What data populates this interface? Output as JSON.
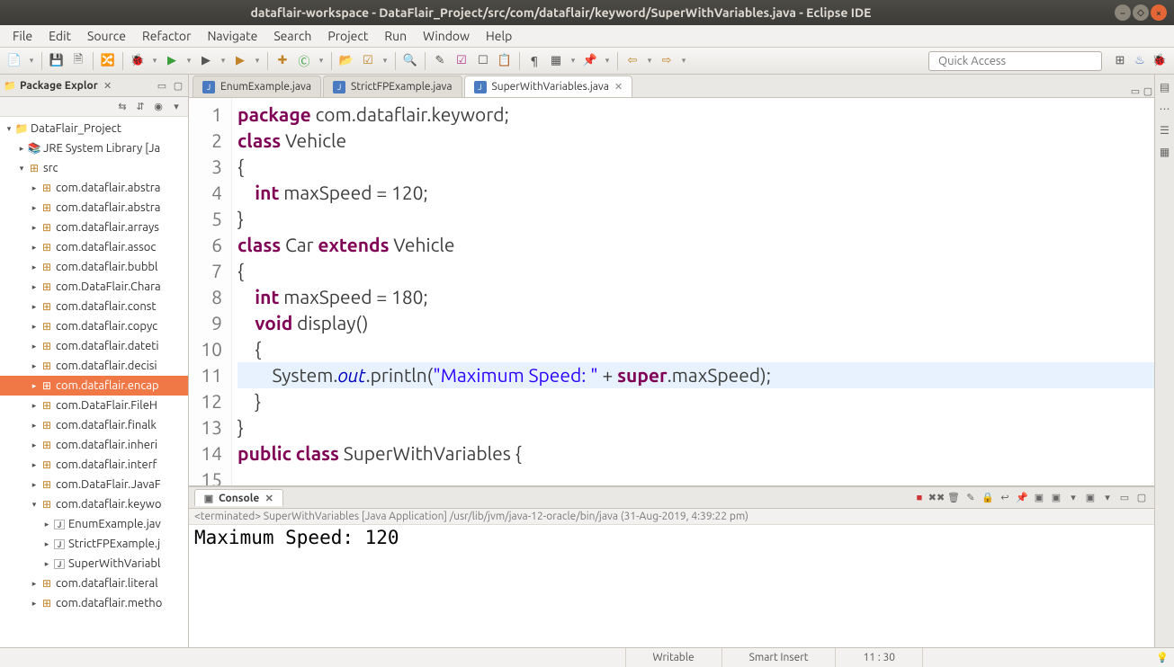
{
  "window": {
    "title": "dataflair-workspace - DataFlair_Project/src/com/dataflair/keyword/SuperWithVariables.java - Eclipse IDE"
  },
  "menu": [
    "File",
    "Edit",
    "Source",
    "Refactor",
    "Navigate",
    "Search",
    "Project",
    "Run",
    "Window",
    "Help"
  ],
  "quick_access": "Quick Access",
  "package_explorer": {
    "title": "Package Explor",
    "project": "DataFlair_Project",
    "jre": "JRE System Library [Ja",
    "src": "src",
    "packages": [
      "com.dataflair.abstra",
      "com.dataflair.abstra",
      "com.dataflair.arrays",
      "com.dataflair.assoc",
      "com.dataflair.bubbl",
      "com.DataFlair.Chara",
      "com.dataflair.const",
      "com.dataflair.copyc",
      "com.dataflair.dateti",
      "com.dataflair.decisi",
      "com.dataflair.encap",
      "com.DataFlair.FileH",
      "com.dataflair.finalk",
      "com.dataflair.inheri",
      "com.dataflair.interf",
      "com.DataFlair.JavaF",
      "com.dataflair.keywo"
    ],
    "files": [
      "EnumExample.jav",
      "StrictFPExample.j",
      "SuperWithVariabl"
    ],
    "trailing": [
      "com.dataflair.literal",
      "com.dataflair.metho"
    ],
    "selected": "com.dataflair.encap"
  },
  "tabs": [
    {
      "label": "EnumExample.java",
      "active": false
    },
    {
      "label": "StrictFPExample.java",
      "active": false
    },
    {
      "label": "SuperWithVariables.java",
      "active": true
    }
  ],
  "code": {
    "lines": [
      {
        "n": 1,
        "html": "<span class='kw'>package</span> com.dataflair.keyword;"
      },
      {
        "n": 2,
        "html": "<span class='kw'>class</span> Vehicle"
      },
      {
        "n": 3,
        "html": "{"
      },
      {
        "n": 4,
        "html": "    <span class='kw'>int</span> maxSpeed = 120;"
      },
      {
        "n": 5,
        "html": "}"
      },
      {
        "n": 6,
        "html": "<span class='kw'>class</span> Car <span class='kw'>extends</span> Vehicle"
      },
      {
        "n": 7,
        "html": "{"
      },
      {
        "n": 8,
        "html": "    <span class='kw'>int</span> maxSpeed = 180;"
      },
      {
        "n": 9,
        "html": "    <span class='kw'>void</span> display()"
      },
      {
        "n": 10,
        "html": "    {"
      },
      {
        "n": 11,
        "html": "        System.<span class='fld'>out</span>.println(<span class='str'>\"Maximum Speed: \"</span> + <span class='kw'>super</span>.maxSpeed);",
        "hl": true
      },
      {
        "n": 12,
        "html": "    }"
      },
      {
        "n": 13,
        "html": "}"
      },
      {
        "n": 14,
        "html": "<span class='kw'>public</span> <span class='kw'>class</span> SuperWithVariables {"
      },
      {
        "n": 15,
        "html": ""
      }
    ]
  },
  "console": {
    "title": "Console",
    "term": "<terminated> SuperWithVariables [Java Application] /usr/lib/jvm/java-12-oracle/bin/java (31-Aug-2019, 4:39:22 pm)",
    "output": "Maximum Speed: 120"
  },
  "status": {
    "writable": "Writable",
    "insert": "Smart Insert",
    "pos": "11 : 30"
  }
}
